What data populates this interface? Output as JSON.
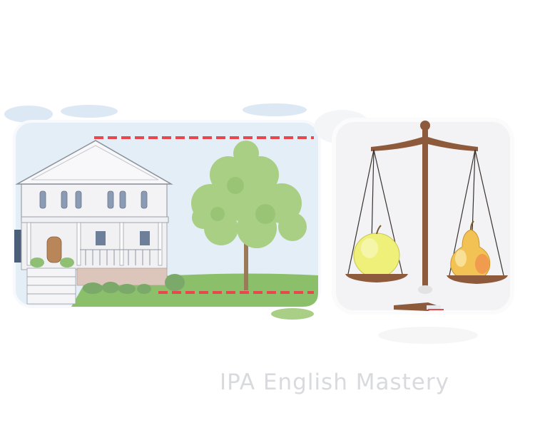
{
  "watermark": {
    "text": "IPA English Mastery"
  },
  "illustrations": {
    "left_panel": {
      "depicts": "house-beside-tree-same-height"
    },
    "right_panel": {
      "depicts": "balance-scale-apple-and-pear"
    }
  },
  "colors": {
    "sky": "#e4eef7",
    "grass": "#8cbf6a",
    "tree": "#a8cf84",
    "house_wall": "#f3f3f5",
    "scale_wood": "#8e5a3c",
    "apple": "#eef07a",
    "pear": "#f2c255",
    "dash": "#e8474d",
    "watermark": "#d9dadd"
  }
}
